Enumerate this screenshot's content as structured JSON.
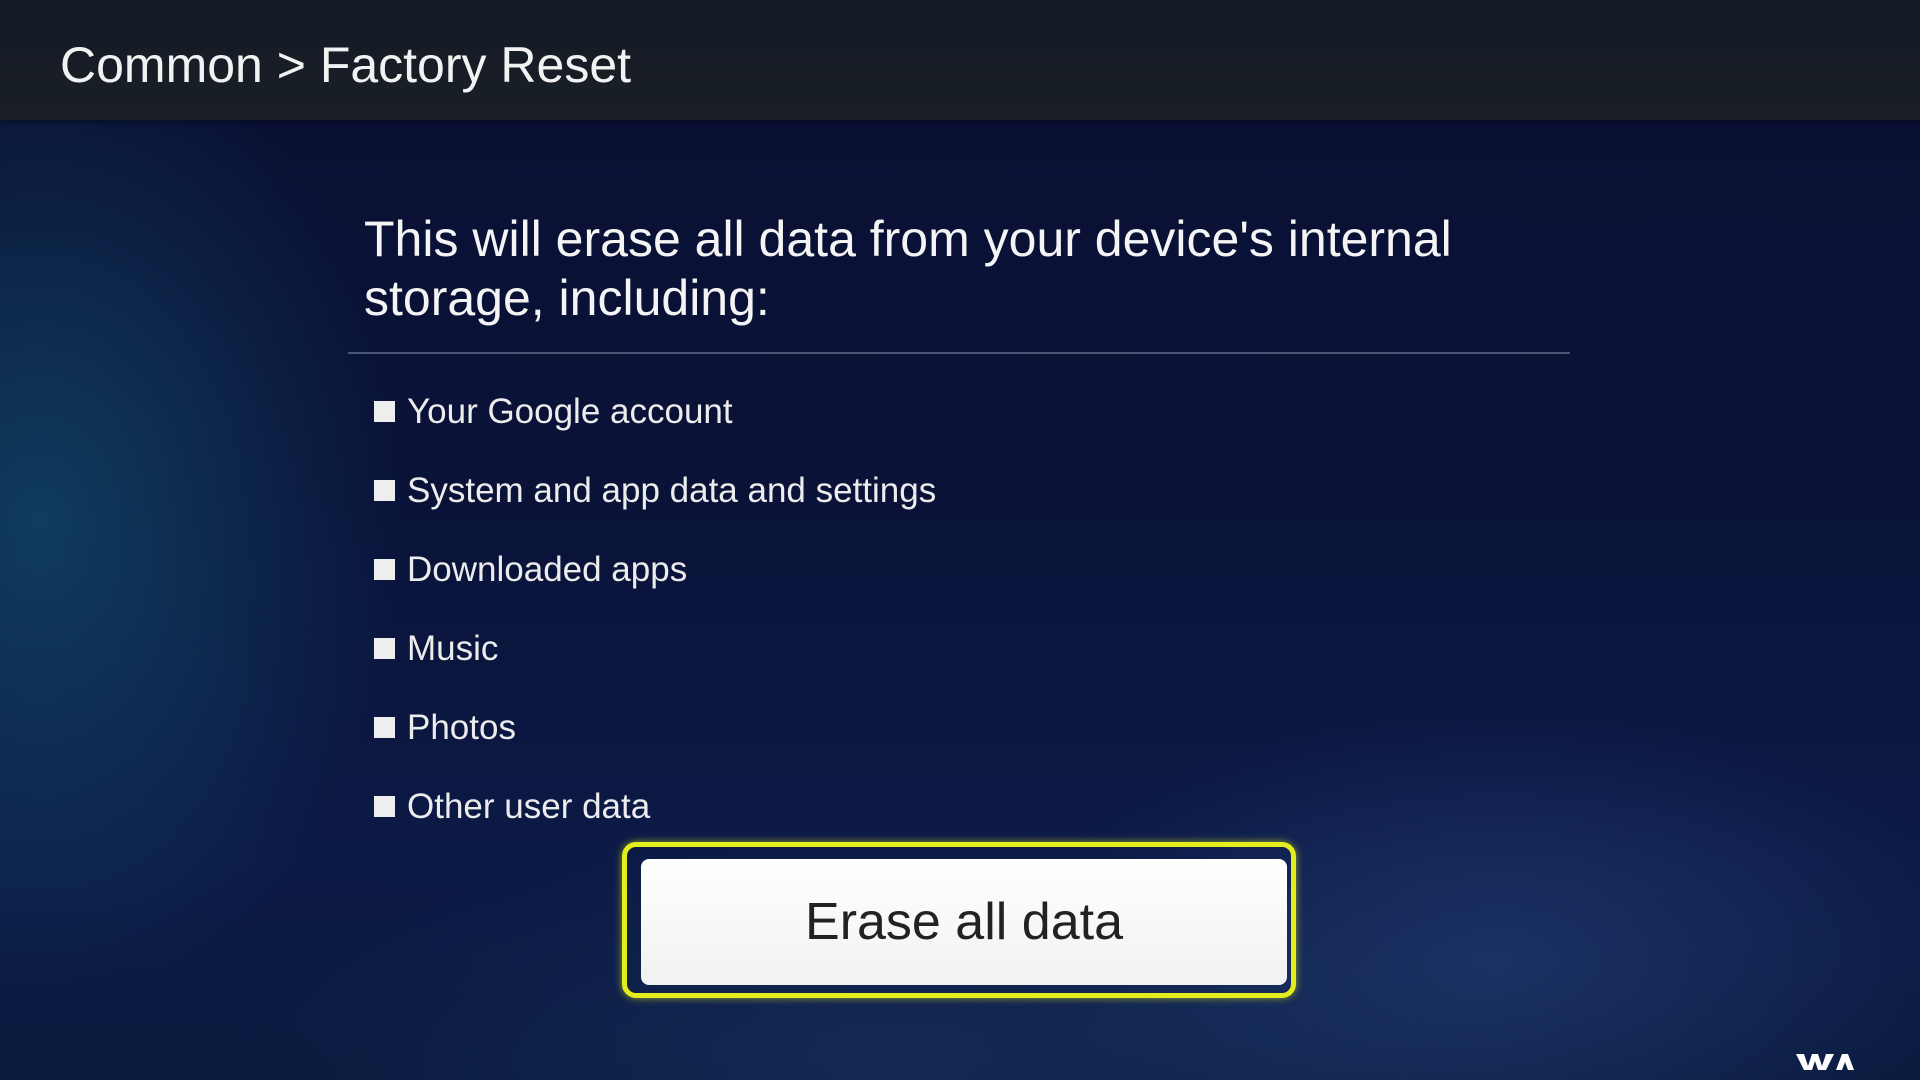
{
  "header": {
    "breadcrumb": "Common > Factory Reset"
  },
  "main": {
    "description": "This will erase all data from your device's internal storage, including:",
    "items": [
      {
        "label": "Your Google account"
      },
      {
        "label": "System and app data and settings"
      },
      {
        "label": "Downloaded apps"
      },
      {
        "label": "Music"
      },
      {
        "label": "Photos"
      },
      {
        "label": "Other user data"
      }
    ],
    "erase_button_label": "Erase all data"
  },
  "colors": {
    "focus_ring": "#e4ee1a",
    "header_bg": "#1a1f27",
    "background": "#0a1238",
    "text": "#f4f4f4"
  },
  "icons": {
    "bullet": "square-bullet-icon",
    "watermark": "watermark-logo"
  }
}
